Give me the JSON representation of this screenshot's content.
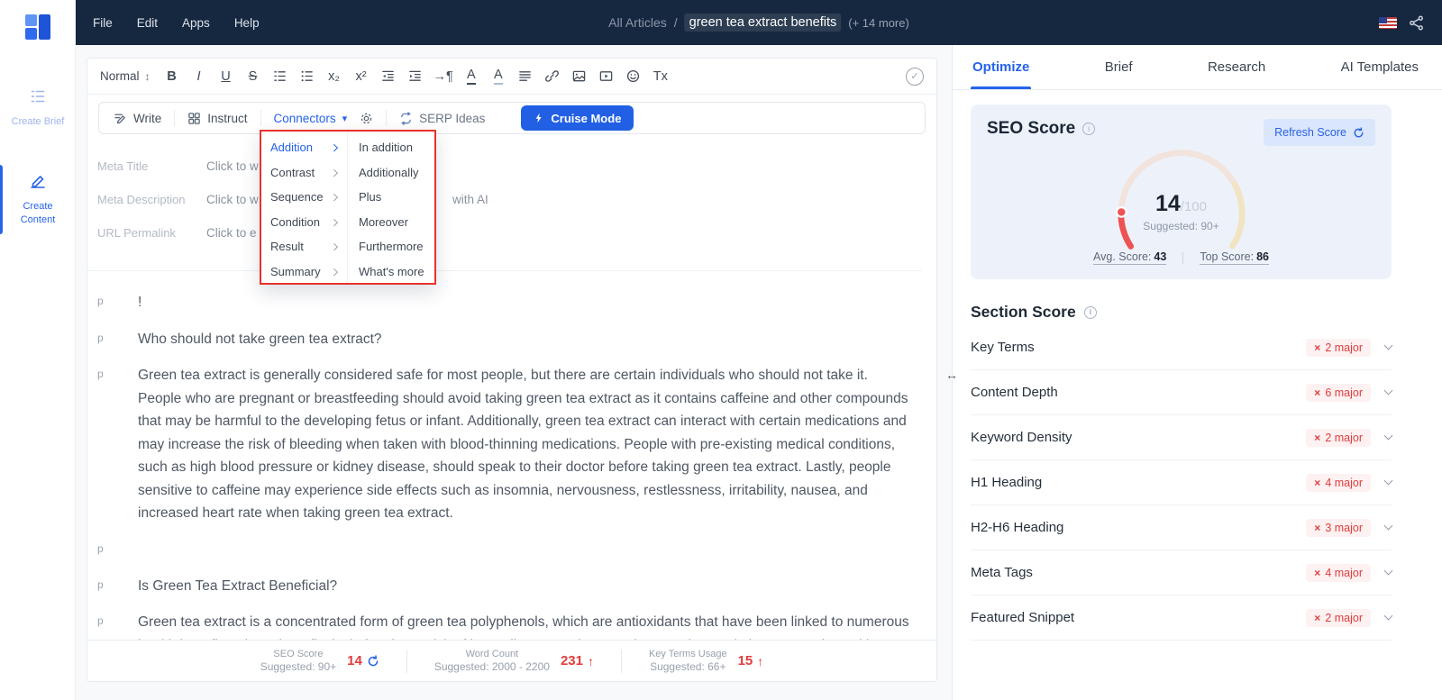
{
  "colors": {
    "accent": "#2563eb",
    "danger": "#e23c3c",
    "topbar_bg": "#16283f",
    "seo_card_bg": "#edf2fa",
    "badge_bg": "#fdf1f1",
    "gauge_red": "#ee5253"
  },
  "icons": {
    "updown": "↕",
    "caret_down": "▾",
    "check": "✓",
    "close": "×",
    "info": "i",
    "arrow_up": "↑",
    "resize": "↔",
    "bold": "B",
    "italic": "I",
    "underline": "U",
    "strike": "S",
    "subscript": "x₂",
    "superscript": "x²",
    "paragraph_direction": "→¶",
    "text_color": "A",
    "highlight": "A",
    "clear_format": "Tx"
  },
  "topbar": {
    "menu": [
      {
        "label": "File"
      },
      {
        "label": "Edit"
      },
      {
        "label": "Apps"
      },
      {
        "label": "Help"
      }
    ],
    "breadcrumb": {
      "root": "All Articles",
      "separator": "/",
      "current": "green tea extract benefits",
      "extra": "(+ 14 more)"
    }
  },
  "sidebar": {
    "items": [
      {
        "label": "Create Brief"
      },
      {
        "label": "Create Content"
      }
    ]
  },
  "editor": {
    "toolbar": {
      "style": "Normal"
    },
    "ai_toolbar": {
      "write": "Write",
      "instruct": "Instruct",
      "connectors": "Connectors",
      "serp": "SERP Ideas",
      "cruise": "Cruise Mode"
    },
    "connectors_menu": {
      "categories": [
        {
          "label": "Addition"
        },
        {
          "label": "Contrast"
        },
        {
          "label": "Sequence"
        },
        {
          "label": "Condition"
        },
        {
          "label": "Result"
        },
        {
          "label": "Summary"
        }
      ],
      "options": [
        {
          "label": "In addition"
        },
        {
          "label": "Additionally"
        },
        {
          "label": "Plus"
        },
        {
          "label": "Moreover"
        },
        {
          "label": "Furthermore"
        },
        {
          "label": "What's more"
        }
      ]
    },
    "meta": [
      {
        "label": "Meta Title",
        "value": "Click to w"
      },
      {
        "label": "Meta Description",
        "value": "Click to w",
        "suffix": "with AI"
      },
      {
        "label": "URL Permalink",
        "value": "Click to e"
      }
    ],
    "paragraphs": [
      {
        "marker": "p",
        "text": "!"
      },
      {
        "marker": "p",
        "text": "Who should not take green tea extract?"
      },
      {
        "marker": "p",
        "text": "Green tea extract is generally considered safe for most people, but there are certain individuals who should not take it. People who are pregnant or breastfeeding should avoid taking green tea extract as it contains caffeine and other compounds that may be harmful to the developing fetus or infant. Additionally, green tea extract can interact with certain medications and may increase the risk of bleeding when taken with blood-thinning medications. People with pre-existing medical conditions, such as high blood pressure or kidney disease, should speak to their doctor before taking green tea extract. Lastly, people sensitive to caffeine may experience side effects such as insomnia, nervousness, restlessness, irritability, nausea, and increased heart rate when taking green tea extract."
      },
      {
        "marker": "p",
        "text": ""
      },
      {
        "marker": "p",
        "text": "Is Green Tea Extract Beneficial?"
      },
      {
        "marker": "p",
        "text": "Green tea extract is a concentrated form of green tea polyphenols, which are antioxidants that have been linked to numerous health benefits. These benefits include a lower risk of heart disease and cancer, improved mental alertness and cognitive"
      }
    ],
    "status": [
      {
        "title": "SEO Score",
        "suggested": "Suggested: 90+",
        "value": "14"
      },
      {
        "title": "Word Count",
        "suggested": "Suggested: 2000 - 2200",
        "value": "231",
        "arrow": "↑"
      },
      {
        "title": "Key Terms Usage",
        "suggested": "Suggested: 66+",
        "value": "15",
        "arrow": "↑"
      }
    ]
  },
  "panel": {
    "tabs": [
      {
        "label": "Optimize"
      },
      {
        "label": "Brief"
      },
      {
        "label": "Research"
      },
      {
        "label": "AI Templates"
      }
    ],
    "seo": {
      "title": "SEO Score",
      "refresh": "Refresh Score",
      "score": "14",
      "total": "/100",
      "suggested": "Suggested: 90+",
      "avg_label": "Avg. Score:",
      "avg_value": "43",
      "top_label": "Top Score:",
      "top_value": "86"
    },
    "section": {
      "title": "Section Score",
      "rows": [
        {
          "label": "Key Terms",
          "badge": "2 major"
        },
        {
          "label": "Content Depth",
          "badge": "6 major"
        },
        {
          "label": "Keyword Density",
          "badge": "2 major"
        },
        {
          "label": "H1 Heading",
          "badge": "4 major"
        },
        {
          "label": "H2-H6 Heading",
          "badge": "3 major"
        },
        {
          "label": "Meta Tags",
          "badge": "4 major"
        },
        {
          "label": "Featured Snippet",
          "badge": "2 major"
        }
      ]
    }
  }
}
